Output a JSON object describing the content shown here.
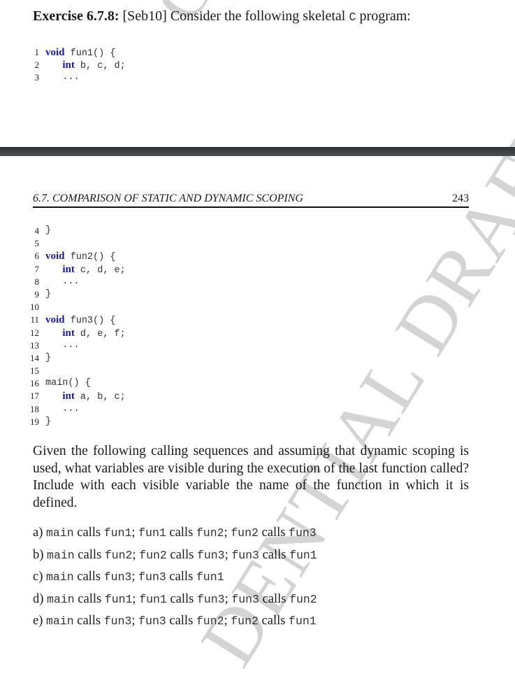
{
  "watermark": {
    "top_fragment": "CO",
    "main_fragment": "DENTIAL DRAFT"
  },
  "exercise": {
    "label": "Exercise 6.7.8:",
    "text": "[Seb10] Consider the following skeletal",
    "lang": "C",
    "text_end": "program:"
  },
  "code_part1": [
    {
      "num": "1",
      "kw": "void",
      "text": " fun1() {"
    },
    {
      "num": "2",
      "indent": "   ",
      "kw": "int",
      "text": " b, c, d;"
    },
    {
      "num": "3",
      "indent": "   ",
      "kw": "",
      "text": "..."
    }
  ],
  "page_header": {
    "section": "6.7.  COMPARISON OF STATIC AND DYNAMIC SCOPING",
    "page_number": "243"
  },
  "code_part2": [
    {
      "num": "4",
      "kw": "",
      "text": "}"
    },
    {
      "num": "5",
      "kw": "",
      "text": ""
    },
    {
      "num": "6",
      "kw": "void",
      "text": " fun2() {"
    },
    {
      "num": "7",
      "indent": "   ",
      "kw": "int",
      "text": " c, d, e;"
    },
    {
      "num": "8",
      "indent": "   ",
      "kw": "",
      "text": "..."
    },
    {
      "num": "9",
      "kw": "",
      "text": "}"
    },
    {
      "num": "10",
      "kw": "",
      "text": ""
    },
    {
      "num": "11",
      "kw": "void",
      "text": " fun3() {"
    },
    {
      "num": "12",
      "indent": "   ",
      "kw": "int",
      "text": " d, e, f;"
    },
    {
      "num": "13",
      "indent": "   ",
      "kw": "",
      "text": "..."
    },
    {
      "num": "14",
      "kw": "",
      "text": "}"
    },
    {
      "num": "15",
      "kw": "",
      "text": ""
    },
    {
      "num": "16",
      "kw": "",
      "text": "main() {"
    },
    {
      "num": "17",
      "indent": "   ",
      "kw": "int",
      "text": " a, b, c;"
    },
    {
      "num": "18",
      "indent": "   ",
      "kw": "",
      "text": "..."
    },
    {
      "num": "19",
      "kw": "",
      "text": "}"
    }
  ],
  "question": "Given the following calling sequences and assuming that dynamic scoping is used, what variables are visible during the execution of the last function called? Include with each visible variable the name of the function in which it is defined.",
  "parts": [
    {
      "label": "a)",
      "calls": [
        [
          "main",
          "fun1"
        ],
        [
          "fun1",
          "fun2"
        ],
        [
          "fun2",
          "fun3"
        ]
      ]
    },
    {
      "label": "b)",
      "calls": [
        [
          "main",
          "fun2"
        ],
        [
          "fun2",
          "fun3"
        ],
        [
          "fun3",
          "fun1"
        ]
      ]
    },
    {
      "label": "c)",
      "calls": [
        [
          "main",
          "fun3"
        ],
        [
          "fun3",
          "fun1"
        ]
      ]
    },
    {
      "label": "d)",
      "calls": [
        [
          "main",
          "fun1"
        ],
        [
          "fun1",
          "fun3"
        ],
        [
          "fun3",
          "fun2"
        ]
      ]
    },
    {
      "label": "e)",
      "calls": [
        [
          "main",
          "fun3"
        ],
        [
          "fun3",
          "fun2"
        ],
        [
          "fun2",
          "fun1"
        ]
      ]
    }
  ],
  "calls_word": "calls",
  "colors": {
    "keyword": "#1a1a9c",
    "watermark": "#d4d4d4",
    "page_break": "#3d4044"
  }
}
